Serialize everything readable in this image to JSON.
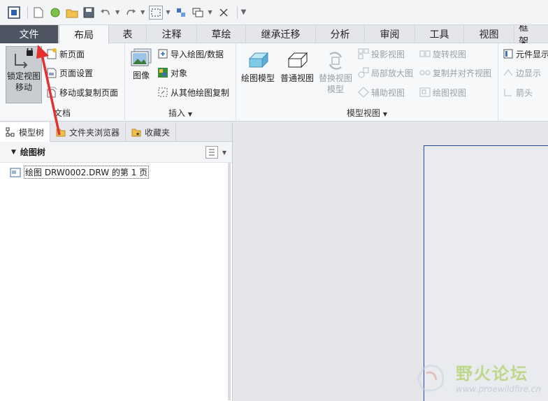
{
  "tabs": {
    "file": "文件",
    "layout": "布局",
    "table": "表",
    "annotate": "注释",
    "sketch": "草绘",
    "legacy": "继承迁移",
    "analysis": "分析",
    "review": "审阅",
    "tools": "工具",
    "view": "视图",
    "frame": "框架"
  },
  "ribbon": {
    "document": {
      "label": "文档",
      "lock_view_move_line1": "锁定视图",
      "lock_view_move_line2": "移动",
      "new_page": "新页面",
      "page_setup": "页面设置",
      "move_copy_page": "移动或复制页面"
    },
    "insert": {
      "label": "插入",
      "image": "图像",
      "import_drawing": "导入绘图/数据",
      "object": "对象",
      "copy_from_drawing": "从其他绘图复制"
    },
    "model_views": {
      "label": "模型视图",
      "drawing_model": "绘图模型",
      "general_view": "普通视图",
      "replace_view_line1": "替换视图",
      "replace_view_line2": "模型",
      "projection_view": "投影视图",
      "detail_view": "局部放大图",
      "auxiliary_view": "辅助视图",
      "revolved_view": "旋转视图",
      "copy_align_view": "复制并对齐视图",
      "drawing_view": "绘图视图"
    },
    "edit": {
      "component_display": "元件显示",
      "edge_display": "边显示",
      "arrow": "箭头"
    }
  },
  "panel": {
    "tabs": {
      "model_tree": "模型树",
      "folder_browser": "文件夹浏览器",
      "favorites": "收藏夹"
    },
    "tree_title": "绘图树",
    "tree_item": "绘图 DRW0002.DRW 的第 1 页"
  },
  "watermark": {
    "title": "野火论坛",
    "url": "www.proewildfire.cn"
  },
  "colors": {
    "file_tab": "#4c5561",
    "sheet_border": "#2a4aa0",
    "annotation_arrow": "#e53030",
    "watermark_green": "#9bc93a"
  }
}
